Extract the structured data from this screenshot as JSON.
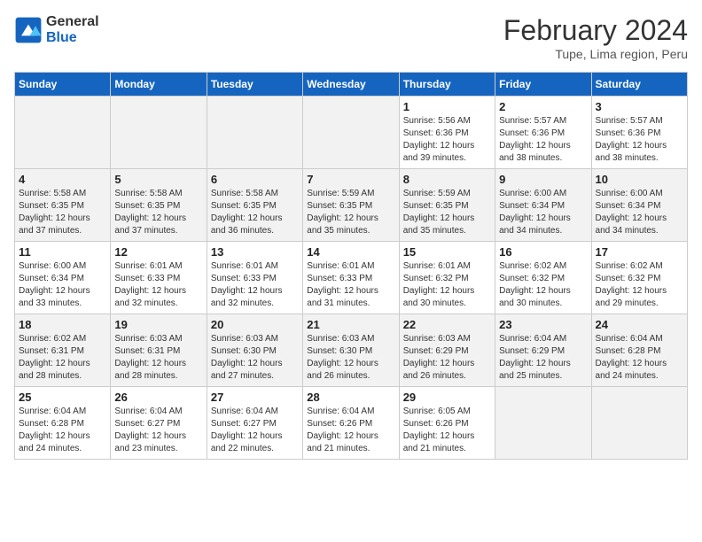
{
  "header": {
    "logo_line1": "General",
    "logo_line2": "Blue",
    "main_title": "February 2024",
    "subtitle": "Tupe, Lima region, Peru"
  },
  "weekdays": [
    "Sunday",
    "Monday",
    "Tuesday",
    "Wednesday",
    "Thursday",
    "Friday",
    "Saturday"
  ],
  "weeks": [
    [
      {
        "day": "",
        "info": ""
      },
      {
        "day": "",
        "info": ""
      },
      {
        "day": "",
        "info": ""
      },
      {
        "day": "",
        "info": ""
      },
      {
        "day": "1",
        "info": "Sunrise: 5:56 AM\nSunset: 6:36 PM\nDaylight: 12 hours\nand 39 minutes."
      },
      {
        "day": "2",
        "info": "Sunrise: 5:57 AM\nSunset: 6:36 PM\nDaylight: 12 hours\nand 38 minutes."
      },
      {
        "day": "3",
        "info": "Sunrise: 5:57 AM\nSunset: 6:36 PM\nDaylight: 12 hours\nand 38 minutes."
      }
    ],
    [
      {
        "day": "4",
        "info": "Sunrise: 5:58 AM\nSunset: 6:35 PM\nDaylight: 12 hours\nand 37 minutes."
      },
      {
        "day": "5",
        "info": "Sunrise: 5:58 AM\nSunset: 6:35 PM\nDaylight: 12 hours\nand 37 minutes."
      },
      {
        "day": "6",
        "info": "Sunrise: 5:58 AM\nSunset: 6:35 PM\nDaylight: 12 hours\nand 36 minutes."
      },
      {
        "day": "7",
        "info": "Sunrise: 5:59 AM\nSunset: 6:35 PM\nDaylight: 12 hours\nand 35 minutes."
      },
      {
        "day": "8",
        "info": "Sunrise: 5:59 AM\nSunset: 6:35 PM\nDaylight: 12 hours\nand 35 minutes."
      },
      {
        "day": "9",
        "info": "Sunrise: 6:00 AM\nSunset: 6:34 PM\nDaylight: 12 hours\nand 34 minutes."
      },
      {
        "day": "10",
        "info": "Sunrise: 6:00 AM\nSunset: 6:34 PM\nDaylight: 12 hours\nand 34 minutes."
      }
    ],
    [
      {
        "day": "11",
        "info": "Sunrise: 6:00 AM\nSunset: 6:34 PM\nDaylight: 12 hours\nand 33 minutes."
      },
      {
        "day": "12",
        "info": "Sunrise: 6:01 AM\nSunset: 6:33 PM\nDaylight: 12 hours\nand 32 minutes."
      },
      {
        "day": "13",
        "info": "Sunrise: 6:01 AM\nSunset: 6:33 PM\nDaylight: 12 hours\nand 32 minutes."
      },
      {
        "day": "14",
        "info": "Sunrise: 6:01 AM\nSunset: 6:33 PM\nDaylight: 12 hours\nand 31 minutes."
      },
      {
        "day": "15",
        "info": "Sunrise: 6:01 AM\nSunset: 6:32 PM\nDaylight: 12 hours\nand 30 minutes."
      },
      {
        "day": "16",
        "info": "Sunrise: 6:02 AM\nSunset: 6:32 PM\nDaylight: 12 hours\nand 30 minutes."
      },
      {
        "day": "17",
        "info": "Sunrise: 6:02 AM\nSunset: 6:32 PM\nDaylight: 12 hours\nand 29 minutes."
      }
    ],
    [
      {
        "day": "18",
        "info": "Sunrise: 6:02 AM\nSunset: 6:31 PM\nDaylight: 12 hours\nand 28 minutes."
      },
      {
        "day": "19",
        "info": "Sunrise: 6:03 AM\nSunset: 6:31 PM\nDaylight: 12 hours\nand 28 minutes."
      },
      {
        "day": "20",
        "info": "Sunrise: 6:03 AM\nSunset: 6:30 PM\nDaylight: 12 hours\nand 27 minutes."
      },
      {
        "day": "21",
        "info": "Sunrise: 6:03 AM\nSunset: 6:30 PM\nDaylight: 12 hours\nand 26 minutes."
      },
      {
        "day": "22",
        "info": "Sunrise: 6:03 AM\nSunset: 6:29 PM\nDaylight: 12 hours\nand 26 minutes."
      },
      {
        "day": "23",
        "info": "Sunrise: 6:04 AM\nSunset: 6:29 PM\nDaylight: 12 hours\nand 25 minutes."
      },
      {
        "day": "24",
        "info": "Sunrise: 6:04 AM\nSunset: 6:28 PM\nDaylight: 12 hours\nand 24 minutes."
      }
    ],
    [
      {
        "day": "25",
        "info": "Sunrise: 6:04 AM\nSunset: 6:28 PM\nDaylight: 12 hours\nand 24 minutes."
      },
      {
        "day": "26",
        "info": "Sunrise: 6:04 AM\nSunset: 6:27 PM\nDaylight: 12 hours\nand 23 minutes."
      },
      {
        "day": "27",
        "info": "Sunrise: 6:04 AM\nSunset: 6:27 PM\nDaylight: 12 hours\nand 22 minutes."
      },
      {
        "day": "28",
        "info": "Sunrise: 6:04 AM\nSunset: 6:26 PM\nDaylight: 12 hours\nand 21 minutes."
      },
      {
        "day": "29",
        "info": "Sunrise: 6:05 AM\nSunset: 6:26 PM\nDaylight: 12 hours\nand 21 minutes."
      },
      {
        "day": "",
        "info": ""
      },
      {
        "day": "",
        "info": ""
      }
    ]
  ]
}
